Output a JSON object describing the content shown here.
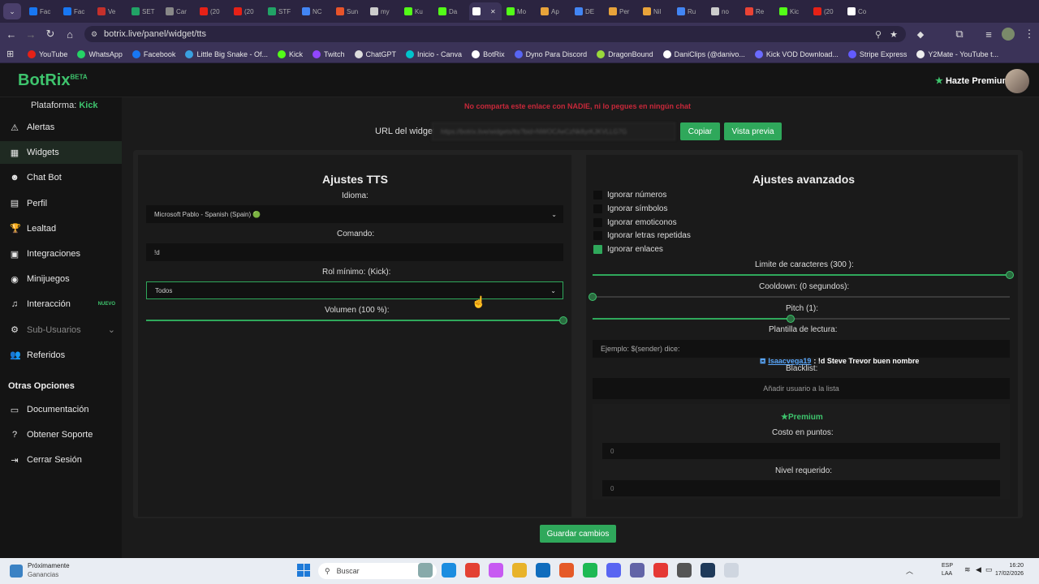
{
  "tabs": [
    {
      "label": "Fac",
      "color": "#1877f2"
    },
    {
      "label": "Fac",
      "color": "#1877f2"
    },
    {
      "label": "Ve",
      "color": "#c4302b"
    },
    {
      "label": "SET",
      "color": "#21a366"
    },
    {
      "label": "Car",
      "color": "#888"
    },
    {
      "label": "(20",
      "color": "#e62117"
    },
    {
      "label": "(20",
      "color": "#e62117"
    },
    {
      "label": "STF",
      "color": "#21a366"
    },
    {
      "label": "NC",
      "color": "#4285f4"
    },
    {
      "label": "Sun",
      "color": "#e8542a"
    },
    {
      "label": "my",
      "color": "#ccc"
    },
    {
      "label": "Ku",
      "color": "#53fc18"
    },
    {
      "label": "Da",
      "color": "#53fc18"
    },
    {
      "label": "",
      "color": "#fff"
    },
    {
      "label": "Mo",
      "color": "#53fc18"
    },
    {
      "label": "Ap",
      "color": "#e8a33a"
    },
    {
      "label": "DE",
      "color": "#4285f4"
    },
    {
      "label": "Per",
      "color": "#e8a33a"
    },
    {
      "label": "Nil",
      "color": "#e8a33a"
    },
    {
      "label": "Ru",
      "color": "#4285f4"
    },
    {
      "label": "no",
      "color": "#ccc"
    },
    {
      "label": "Re",
      "color": "#ea4335"
    },
    {
      "label": "Kic",
      "color": "#53fc18"
    },
    {
      "label": "(20",
      "color": "#e62117"
    },
    {
      "label": "Co",
      "color": "#fff"
    }
  ],
  "address": {
    "url": "botrix.live/panel/widget/tts"
  },
  "bookmarks": [
    {
      "label": "YouTube",
      "color": "#e62117"
    },
    {
      "label": "WhatsApp",
      "color": "#25d366"
    },
    {
      "label": "Facebook",
      "color": "#1877f2"
    },
    {
      "label": "Little Big Snake - Of...",
      "color": "#3aa0e0"
    },
    {
      "label": "Kick",
      "color": "#53fc18"
    },
    {
      "label": "Twitch",
      "color": "#9146ff"
    },
    {
      "label": "ChatGPT",
      "color": "#ddd"
    },
    {
      "label": "Inicio - Canva",
      "color": "#00c4cc"
    },
    {
      "label": "BotRix",
      "color": "#fff"
    },
    {
      "label": "Dyno Para Discord",
      "color": "#5865f2"
    },
    {
      "label": "DragonBound",
      "color": "#9ad93b"
    },
    {
      "label": "DaniClips (@danivo...",
      "color": "#fff"
    },
    {
      "label": "Kick VOD Download...",
      "color": "#6b6bff"
    },
    {
      "label": "Stripe Express",
      "color": "#635bff"
    },
    {
      "label": "Y2Mate - YouTube t...",
      "color": "#eee"
    }
  ],
  "header": {
    "logo": "BotRix",
    "logo_sup": "BETA",
    "premium": "Hazte Premium"
  },
  "sidebar": {
    "platform_label": "Plataforma:",
    "platform_value": "Kick",
    "items": [
      {
        "label": "Alertas",
        "icon": "⚠"
      },
      {
        "label": "Widgets",
        "icon": "▦"
      },
      {
        "label": "Chat Bot",
        "icon": "☻"
      },
      {
        "label": "Perfil",
        "icon": "▤"
      },
      {
        "label": "Lealtad",
        "icon": "🏆"
      },
      {
        "label": "Integraciones",
        "icon": "▣"
      },
      {
        "label": "Minijuegos",
        "icon": "◉"
      },
      {
        "label": "Interacción",
        "icon": "♫",
        "badge": "NUEVO"
      },
      {
        "label": "Sub-Usuarios",
        "icon": "⚙"
      },
      {
        "label": "Referidos",
        "icon": "👥"
      }
    ],
    "other_title": "Otras Opciones",
    "other_items": [
      {
        "label": "Documentación",
        "icon": "▭"
      },
      {
        "label": "Obtener Soporte",
        "icon": "?"
      },
      {
        "label": "Cerrar Sesión",
        "icon": "⇥"
      }
    ]
  },
  "main": {
    "warning": "No comparta este enlace con NADIE, ni lo pegues en ningún chat",
    "url_label": "URL del widget:",
    "url_value": "https://botrix.live/widgets/tts?bid=NWOCAeCzNk8yrKJKVLLG7G",
    "copy": "Copiar",
    "preview": "Vista previa",
    "save": "Guardar cambios"
  },
  "tts": {
    "title": "Ajustes TTS",
    "language_label": "Idioma:",
    "language_value": "Microsoft Pablo - Spanish (Spain) 🟢",
    "command_label": "Comando:",
    "command_value": "!d",
    "role_label": "Rol mínimo: (Kick):",
    "role_value": "Todos",
    "volume_label": "Volumen (100 %):",
    "volume_level": 1.0
  },
  "advanced": {
    "title": "Ajustes avanzados",
    "options": [
      {
        "label": "Ignorar números",
        "checked": false
      },
      {
        "label": "Ignorar símbolos",
        "checked": false
      },
      {
        "label": "Ignorar emoticonos",
        "checked": false
      },
      {
        "label": "Ignorar letras repetidas",
        "checked": false
      },
      {
        "label": "Ignorar enlaces",
        "checked": true
      }
    ],
    "char_limit_label": "Limite de caracteres (300 ):",
    "char_limit_level": 1.0,
    "cooldown_label": "Cooldown: (0 segundos):",
    "cooldown_level": 0.0,
    "pitch_label": "Pitch (1):",
    "pitch_level": 0.475,
    "template_label": "Plantilla de lectura:",
    "template_placeholder": "Ejemplo: $(sender) dice:",
    "example_user": "Isaacvega19",
    "example_text": ": !d Steve Trevor buen nombre",
    "blacklist_label": "Blacklist:",
    "blacklist_placeholder": "Añadir usuario a la lista",
    "premium_title": "Premium",
    "cost_label": "Costo en puntos:",
    "cost_value": "0",
    "level_label": "Nivel requerido:",
    "level_value": "0"
  },
  "taskbar": {
    "weather_title": "Próximamente",
    "weather_sub": "Ganancias",
    "search": "Buscar",
    "lang": "ESP",
    "lang_sub": "LAA",
    "time": "16:20",
    "date": "17/02/2026"
  }
}
